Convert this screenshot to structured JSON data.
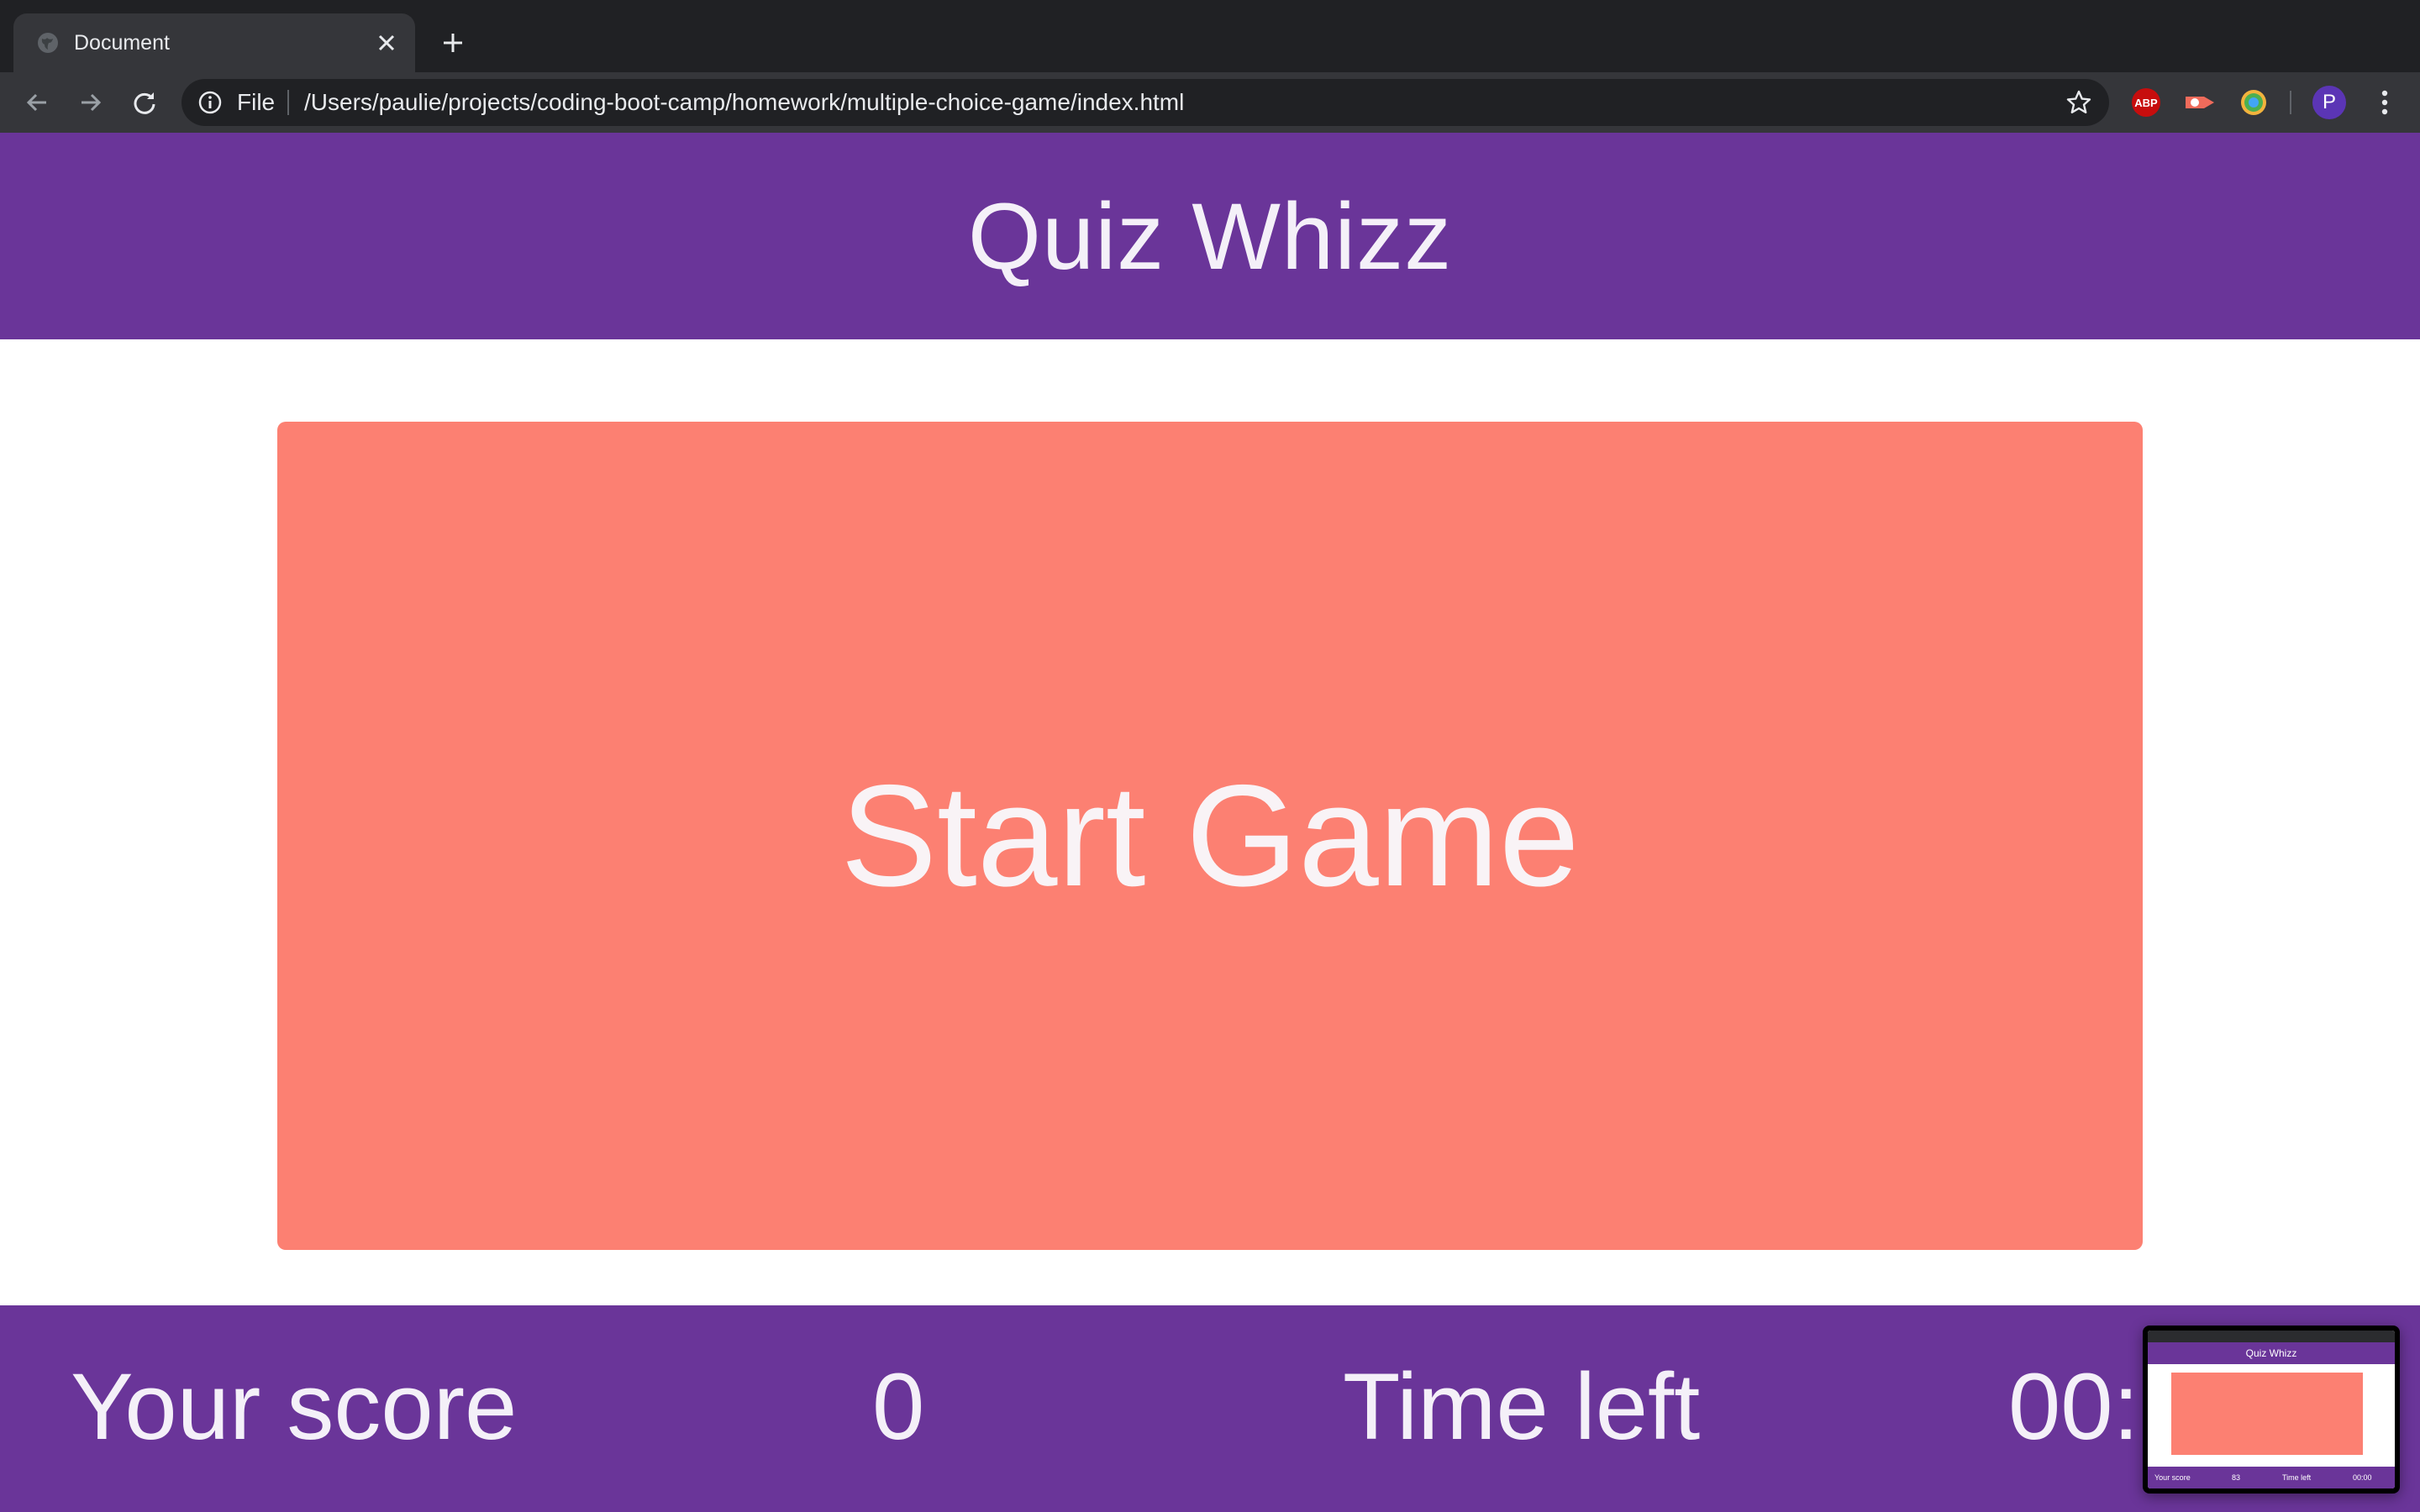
{
  "browser": {
    "tab_title": "Document",
    "address_scheme": "File",
    "address_url": "/Users/paulie/projects/coding-boot-camp/homework/multiple-choice-game/index.html",
    "extensions": [
      "adblock-plus",
      "recording-extension",
      "colorful-extension"
    ],
    "profile_initial": "P"
  },
  "page": {
    "title": "Quiz Whizz",
    "start_button": "Start Game",
    "footer": {
      "score_label": "Your score",
      "score_value": "0",
      "time_label": "Time left",
      "time_value": "00:"
    }
  },
  "thumbnail": {
    "title": "Quiz Whizz",
    "score_label": "Your score",
    "score_value": "83",
    "time_label": "Time left",
    "time_value": "00:00"
  },
  "colors": {
    "header_purple": "#6a3599",
    "start_button_salmon": "#fc8072",
    "chrome_dark": "#202124",
    "chrome_toolbar": "#35363a"
  }
}
